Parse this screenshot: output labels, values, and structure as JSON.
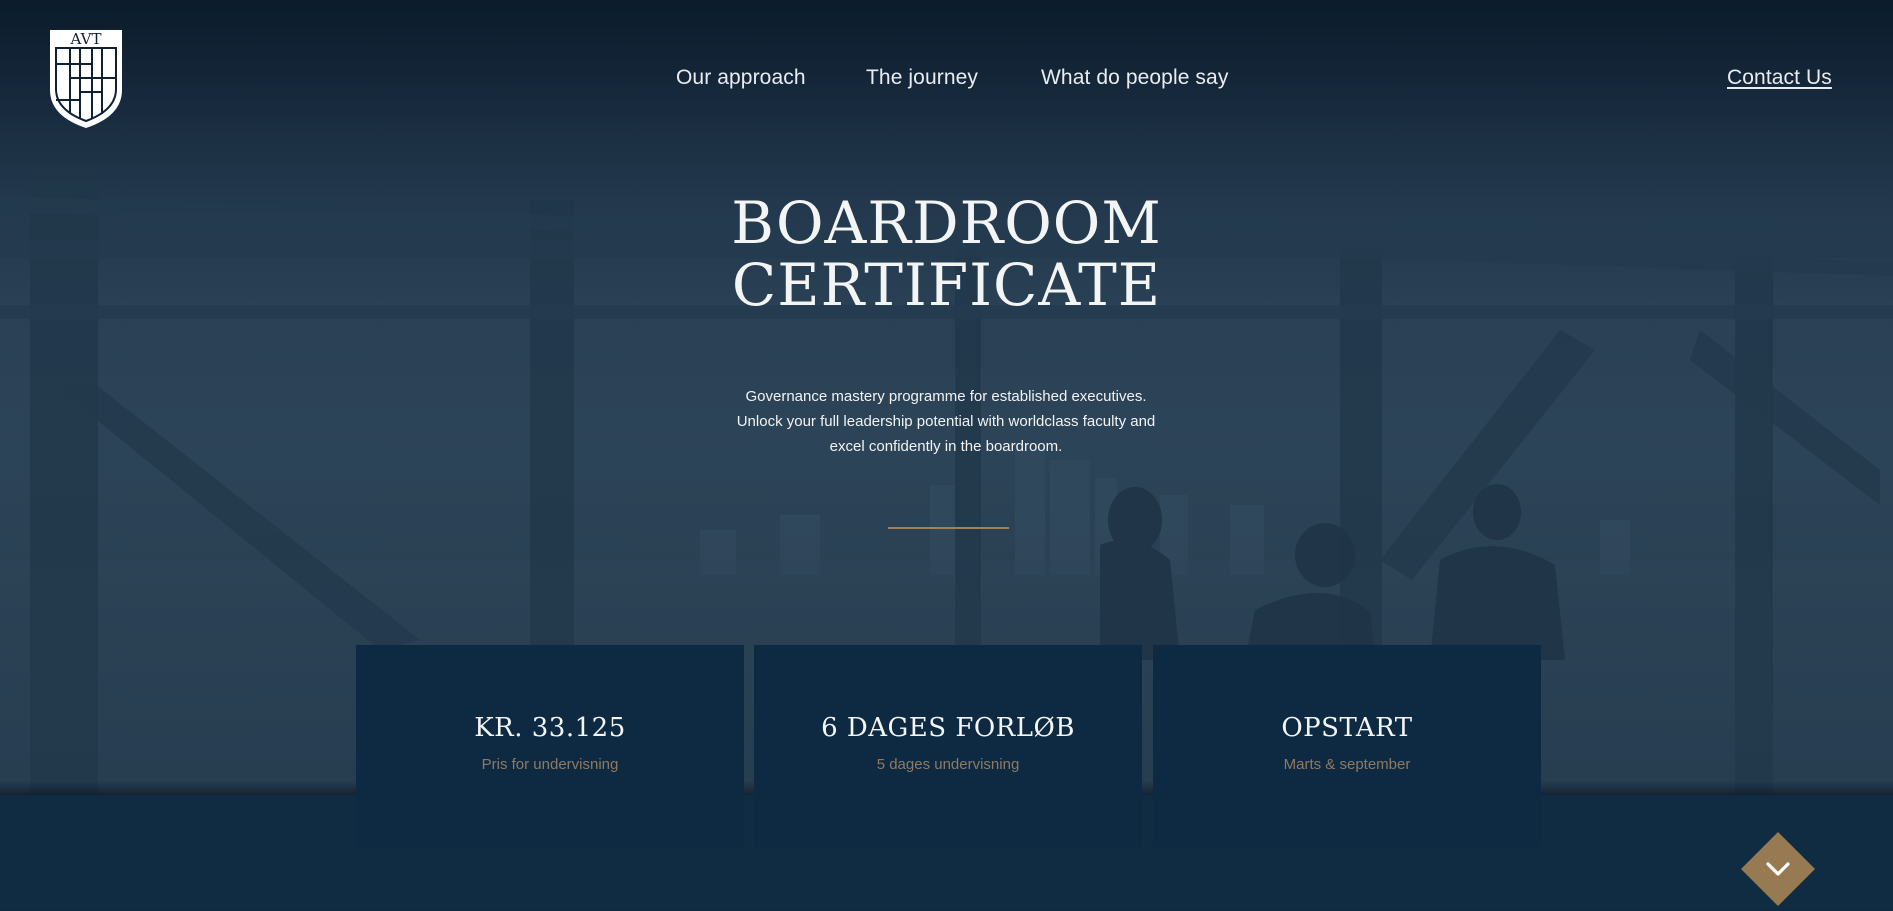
{
  "brand": {
    "logo_text": "AVT",
    "logo_icon": "shield-crest-icon"
  },
  "nav": {
    "items": [
      {
        "label": "Our approach"
      },
      {
        "label": "The journey"
      },
      {
        "label": "What do people say"
      }
    ],
    "contact_label": "Contact Us"
  },
  "hero": {
    "title_line1": "BOARDROOM",
    "title_line2": "CERTIFICATE",
    "subtitle_line1": "Governance mastery programme for established executives.",
    "subtitle_line2": "Unlock your full leadership potential with worldclass faculty and",
    "subtitle_line3": "excel confidently in the boardroom."
  },
  "cards": [
    {
      "title": "KR. 33.125",
      "subtitle": "Pris for undervisning"
    },
    {
      "title": "6 DAGES FORLØB",
      "subtitle": "5 dages undervisning"
    },
    {
      "title": "OPSTART",
      "subtitle": "Marts & september"
    }
  ],
  "scroll": {
    "icon": "chevron-down-icon"
  },
  "colors": {
    "accent": "#977a52",
    "card_bg": "#0d2a42",
    "band_bg": "#0f2c43",
    "text": "#f3f4f4",
    "card_subtext": "#8f7a60"
  }
}
